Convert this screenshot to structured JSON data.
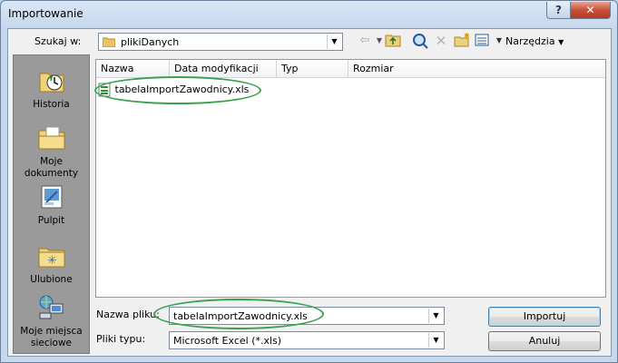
{
  "window": {
    "title": "Importowanie",
    "help_label": "?",
    "close_label": "✕"
  },
  "toolbar": {
    "look_in_label": "Szukaj w:",
    "look_in_value": "plikiDanych",
    "tools_label": "Narzędzia"
  },
  "places": [
    {
      "label": "Historia",
      "icon": "history-icon"
    },
    {
      "label": "Moje dokumenty",
      "icon": "documents-folder-icon"
    },
    {
      "label": "Pulpit",
      "icon": "desktop-icon"
    },
    {
      "label": "Ulubione",
      "icon": "favorites-folder-icon"
    },
    {
      "label": "Moje miejsca sieciowe",
      "icon": "network-places-icon"
    }
  ],
  "file_list": {
    "columns": [
      "Nazwa",
      "Data modyfikacji",
      "Typ",
      "Rozmiar"
    ],
    "files": [
      {
        "name": "tabelaImportZawodnicy.xls",
        "icon": "excel-file-icon"
      }
    ]
  },
  "form": {
    "filename_label": "Nazwa pliku:",
    "filename_value": "tabelaImportZawodnicy.xls",
    "filetype_label": "Pliki typu:",
    "filetype_value": "Microsoft Excel (*.xls)"
  },
  "buttons": {
    "import_label": "Importuj",
    "cancel_label": "Anuluj"
  },
  "colors": {
    "annotation": "#3aa14f",
    "places_bg": "#9a9a9a",
    "close_red": "#c7503a"
  }
}
